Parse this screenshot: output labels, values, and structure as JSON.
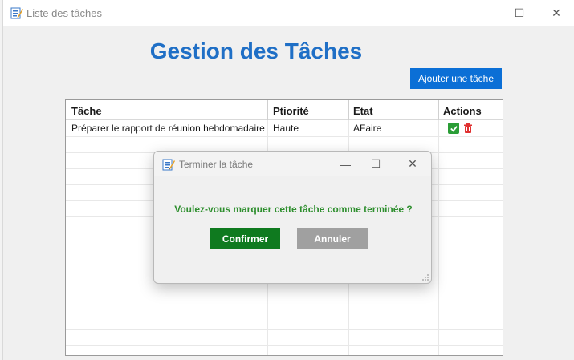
{
  "main_window": {
    "title": "Liste des tâches",
    "heading": "Gestion des Tâches",
    "add_button_label": "Ajouter une tâche",
    "controls": {
      "minimize": "—",
      "maximize": "☐",
      "close": "✕"
    }
  },
  "table": {
    "columns": [
      "Tâche",
      "Ptiorité",
      "Etat",
      "Actions"
    ],
    "rows": [
      {
        "task": "Préparer le rapport de réunion hebdomadaire",
        "priority": "Haute",
        "status": "AFaire",
        "actions": [
          "check-icon",
          "trash-icon"
        ]
      }
    ]
  },
  "dialog": {
    "title": "Terminer la tâche",
    "question": "Voulez-vous marquer cette tâche comme terminée ?",
    "confirm_label": "Confirmer",
    "cancel_label": "Annuler",
    "controls": {
      "minimize": "—",
      "maximize": "☐",
      "close": "✕"
    }
  },
  "colors": {
    "heading": "#1f6fc6",
    "add_button": "#0b6fd6",
    "question_text": "#2f8f2f",
    "confirm_button": "#0f7a1f",
    "cancel_button": "#a0a0a0",
    "check_icon": "#2a9d36",
    "trash_icon": "#e03030"
  }
}
